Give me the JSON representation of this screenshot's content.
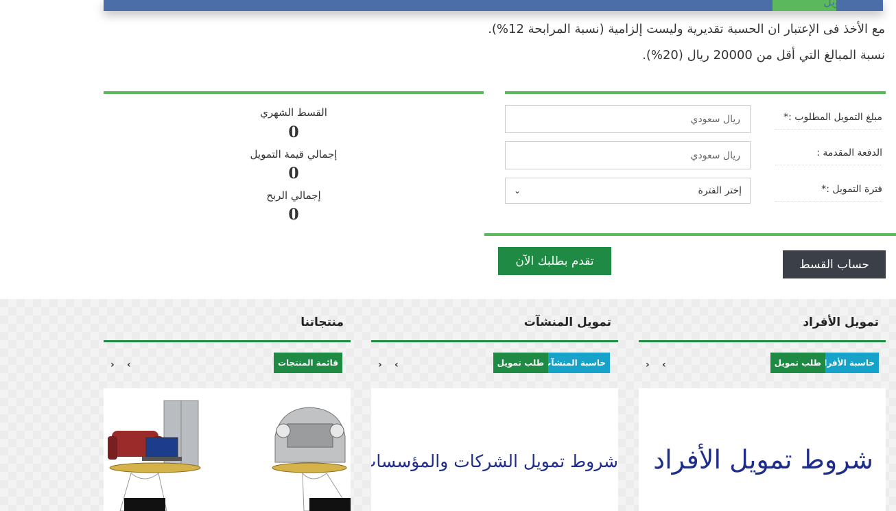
{
  "top": {
    "cut_title": "حساب تمويل"
  },
  "notes": [
    "مع الأخذ فى الإعتبار ان الحسبة تقديرية وليست إلزامية (نسبة المرابحة 12%).",
    "نسبة المبالغ التي أقل من 20000 ريال (20%)."
  ],
  "form": {
    "amount_label": "مبلغ التمويل المطلوب :*",
    "amount_placeholder": "ريال سعودي",
    "down_label": "الدفعة المقدمة :",
    "down_placeholder": "ريال سعودي",
    "period_label": "فترة التمويل :*",
    "period_value": "إختر الفترة"
  },
  "results": {
    "monthly_label": "القسط الشهري",
    "monthly_value": "0",
    "total_label": "إجمالي قيمة التمويل",
    "total_value": "0",
    "profit_label": "إجمالي الربح",
    "profit_value": "0"
  },
  "buttons": {
    "apply": "تقدم بطلبك الآن",
    "calc": "حساب القسط"
  },
  "sections": {
    "individuals": {
      "title": "تمويل الأفراد",
      "calc_tag": "حاسبة الأفراد",
      "request_tag": "طلب تمويل",
      "card_text": "شروط تمويل الأفراد"
    },
    "companies": {
      "title": "تمويل المنشآت",
      "calc_tag": "حاسبة المنشآت",
      "request_tag": "طلب تمويل",
      "card_text": "شروط تمويل الشركات والمؤسسات"
    },
    "products": {
      "title": "منتجاتنا",
      "list_tag": "قائمة المنتجات"
    }
  },
  "icons": {
    "prev": "chevron-left-icon",
    "next": "chevron-right-icon"
  },
  "colors": {
    "accent_green": "#5cb85c",
    "dark_green": "#1e8a43",
    "blue_tag": "#17a2c9",
    "dark_button": "#3b4048",
    "header_blue": "#4a6ea8"
  }
}
